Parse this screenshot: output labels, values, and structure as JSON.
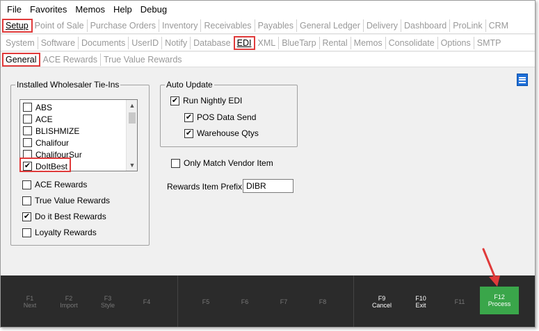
{
  "menu": [
    "File",
    "Favorites",
    "Memos",
    "Help",
    "Debug"
  ],
  "tabs1": [
    {
      "label": "Setup",
      "active": true,
      "highlight": true
    },
    {
      "label": "Point of Sale"
    },
    {
      "label": "Purchase Orders"
    },
    {
      "label": "Inventory"
    },
    {
      "label": "Receivables"
    },
    {
      "label": "Payables"
    },
    {
      "label": "General Ledger"
    },
    {
      "label": "Delivery"
    },
    {
      "label": "Dashboard"
    },
    {
      "label": "ProLink"
    },
    {
      "label": "CRM"
    }
  ],
  "tabs2": [
    {
      "label": "System"
    },
    {
      "label": "Software"
    },
    {
      "label": "Documents"
    },
    {
      "label": "UserID"
    },
    {
      "label": "Notify"
    },
    {
      "label": "Database"
    },
    {
      "label": "EDI",
      "active": true,
      "highlight": true
    },
    {
      "label": "XML"
    },
    {
      "label": "BlueTarp"
    },
    {
      "label": "Rental"
    },
    {
      "label": "Memos"
    },
    {
      "label": "Consolidate"
    },
    {
      "label": "Options"
    },
    {
      "label": "SMTP"
    }
  ],
  "tabs3": [
    {
      "label": "General",
      "active": true,
      "highlight": true
    },
    {
      "label": "ACE Rewards"
    },
    {
      "label": "True Value Rewards"
    }
  ],
  "wholesaler": {
    "title": "Installed Wholesaler Tie-Ins",
    "items": [
      {
        "label": "ABS",
        "checked": false
      },
      {
        "label": "ACE",
        "checked": false
      },
      {
        "label": "BLISHMIZE",
        "checked": false
      },
      {
        "label": "Chalifour",
        "checked": false
      },
      {
        "label": "ChalifourSur",
        "checked": false
      },
      {
        "label": "DoItBest",
        "checked": true
      }
    ],
    "rewards": [
      {
        "label": "ACE Rewards",
        "checked": false
      },
      {
        "label": "True Value Rewards",
        "checked": false
      },
      {
        "label": "Do it Best Rewards",
        "checked": true
      },
      {
        "label": "Loyalty Rewards",
        "checked": false
      }
    ]
  },
  "auto_update": {
    "title": "Auto Update",
    "run_nightly": {
      "label": "Run Nightly EDI",
      "checked": true
    },
    "pos_data_send": {
      "label": "POS Data Send",
      "checked": true
    },
    "warehouse_qtys": {
      "label": "Warehouse Qtys",
      "checked": true
    }
  },
  "only_match": {
    "label": "Only Match Vendor Item",
    "checked": false
  },
  "rewards_prefix": {
    "label": "Rewards Item Prefix:",
    "value": "DIBR"
  },
  "fkeys": [
    {
      "key": "F1",
      "label": "Next"
    },
    {
      "key": "F2",
      "label": "Import"
    },
    {
      "key": "F3",
      "label": "Style"
    },
    {
      "key": "F4",
      "label": ""
    },
    {
      "key": "F5",
      "label": ""
    },
    {
      "key": "F6",
      "label": ""
    },
    {
      "key": "F7",
      "label": ""
    },
    {
      "key": "F8",
      "label": ""
    },
    {
      "key": "F9",
      "label": "Cancel"
    },
    {
      "key": "F10",
      "label": "Exit"
    },
    {
      "key": "F11",
      "label": ""
    },
    {
      "key": "F12",
      "label": "Process"
    }
  ],
  "colors": {
    "highlight": "#e03a3a",
    "process": "#3aa64a",
    "fkeybar": "#2b2b2b",
    "menu_icon": "#1e6fd8"
  }
}
